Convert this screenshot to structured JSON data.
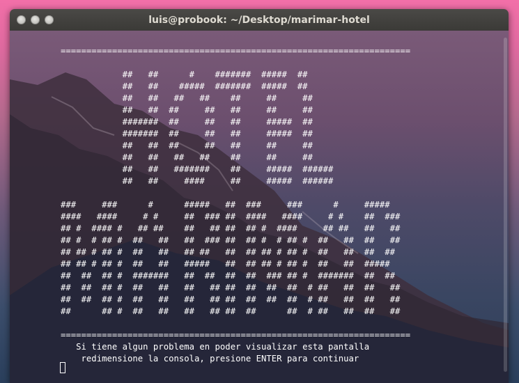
{
  "window": {
    "title": "luis@probook: ~/Desktop/marimar-hotel",
    "controls": [
      "close-icon",
      "minimize-icon",
      "maximize-icon"
    ]
  },
  "terminal": {
    "lines": [
      "====================================================================",
      "",
      "            ##   ##      #    #######  #####  ##",
      "            ##   ##    #####  #######  #####  ##",
      "            ##   ##   ##   ##    ##     ##     ##",
      "            ##   ##  ##     ##   ##     ##     ##",
      "            #######  ##     ##   ##     #####  ##",
      "            #######  ##     ##   ##     #####  ##",
      "            ##   ##  ##     ##   ##     ##     ##",
      "            ##   ##   ##   ##    ##     ##     ##",
      "            ##   ##   #######    ##     #####  ######",
      "            ##   ##     ####     ##     #####  ######",
      "",
      "###     ###      #      #####   ##  ###     ###      #     #####",
      "####   ####     # #     ##  ### ##  ####   ####     # #    ##  ###",
      "## #  #### #   ## ##    ##   ## ##  ## #  ####     ## ##   ##   ##",
      "## #  # ## #  ##   ##   ##  ### ##  ## #  # ## #  ##   ##  ##   ##",
      "## ## # ## #  ##   ##   ## ##   ##  ## ## # ## #  ##   ##  ##  ##",
      "## ## # ## #  ##   ##   #####   ##  ## ## # ## #  ##   ##  #####",
      "##  ##  ## #  #######   ##  ##  ##  ##  ### ## #  #######  ##  ##",
      "##  ##  ## #  ##   ##   ##   ## ##  ##  ##  ##  # ##   ##  ##   ##",
      "##  ##  ## #  ##   ##   ##   ## ##  ##  ##  ##  # ##   ##  ##   ##",
      "##      ## #  ##   ##   ##   ## ##  ##      ##  # ##   ##  ##   ##",
      "",
      "====================================================================",
      "   Si tiene algun problema en poder visualizar esta pantalla",
      "    redimensione la consola, presione ENTER para continuar"
    ]
  },
  "colors": {
    "titlebar": "#3c3b37",
    "title_text": "#dfdbd2",
    "terminal_text": "#ffffff",
    "desktop_accent": "#f26fa8"
  }
}
